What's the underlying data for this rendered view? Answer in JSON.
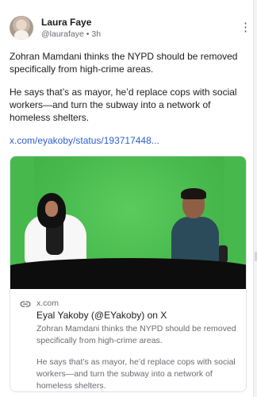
{
  "post": {
    "author_name": "Laura Faye",
    "handle": "@laurafaye",
    "time_separator": "•",
    "time": "3h",
    "paragraphs": [
      "Zohran Mamdani thinks the NYPD should be removed specifically from high-crime areas.",
      "He says that’s as mayor, he’d replace cops with social workers—and turn the subway into a network of homeless shelters."
    ],
    "link_text": "x.com/eyakoby/status/193717448..."
  },
  "embed": {
    "domain": "x.com",
    "title": "Eyal Yakoby (@EYakoby) on X",
    "description": [
      "Zohran Mamdani thinks the NYPD should be removed specifically from high-crime areas.",
      "He says that’s as mayor, he’d replace cops with social workers—and turn the subway into a network of homeless shelters."
    ]
  },
  "icons": {
    "menu": "more-vertical-icon",
    "link": "link-icon"
  },
  "colors": {
    "link": "#2d5fd1",
    "green_screen": "#47b94c",
    "muted_text": "#6b6b73"
  }
}
